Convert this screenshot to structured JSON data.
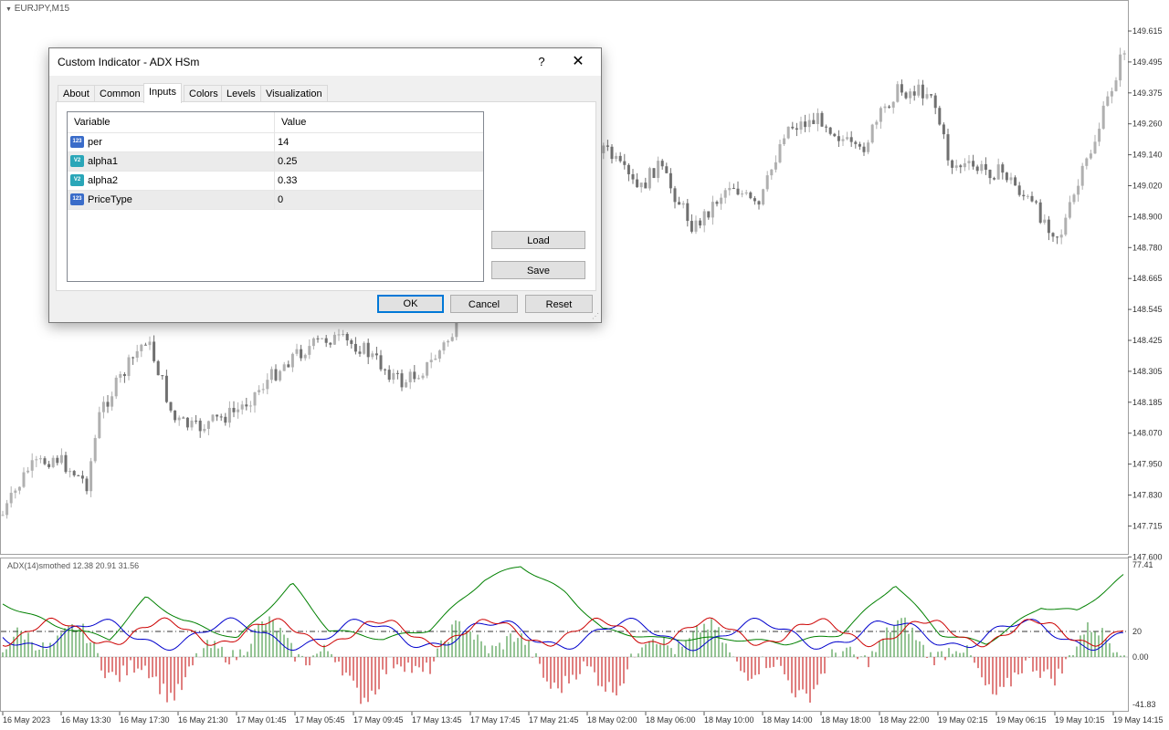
{
  "chart": {
    "symbol_title": "EURJPY,M15",
    "indicator_title": "ADX(14)smothed 12.38 20.91 31.56",
    "price_labels": [
      "149.615",
      "149.495",
      "149.375",
      "149.260",
      "149.140",
      "149.020",
      "148.900",
      "148.780",
      "148.665",
      "148.545",
      "148.425",
      "148.305",
      "148.185",
      "148.070",
      "147.950",
      "147.830",
      "147.715",
      "147.600"
    ],
    "indicator_labels": [
      "77.41",
      "20",
      "0.00",
      "-41.83"
    ],
    "time_labels": [
      "16 May 2023",
      "16 May 13:30",
      "16 May 17:30",
      "16 May 21:30",
      "17 May 01:45",
      "17 May 05:45",
      "17 May 09:45",
      "17 May 13:45",
      "17 May 17:45",
      "17 May 21:45",
      "18 May 02:00",
      "18 May 06:00",
      "18 May 10:00",
      "18 May 14:00",
      "18 May 18:00",
      "18 May 22:00",
      "19 May 02:15",
      "19 May 06:15",
      "19 May 10:15",
      "19 May 14:15"
    ],
    "colors": {
      "bull": "#b0b0b0",
      "bear": "#707070",
      "adx": "#008000",
      "plus_di": "#0000cc",
      "minus_di": "#cc0000",
      "hist_pos": "#2e8b2e",
      "hist_neg": "#c00000"
    }
  },
  "dialog": {
    "title": "Custom Indicator - ADX HSm",
    "help_label": "?",
    "close_label": "✕",
    "tabs": [
      "About",
      "Common",
      "Inputs",
      "Colors",
      "Levels",
      "Visualization"
    ],
    "active_tab": "Inputs",
    "grid_headers": {
      "variable": "Variable",
      "value": "Value"
    },
    "rows": [
      {
        "icon": "123",
        "variable": "per",
        "value": "14"
      },
      {
        "icon": "V2",
        "variable": "alpha1",
        "value": "0.25"
      },
      {
        "icon": "V2",
        "variable": "alpha2",
        "value": "0.33"
      },
      {
        "icon": "123",
        "variable": "PriceType",
        "value": "0"
      }
    ],
    "buttons": {
      "load": "Load",
      "save": "Save",
      "ok": "OK",
      "cancel": "Cancel",
      "reset": "Reset"
    }
  }
}
